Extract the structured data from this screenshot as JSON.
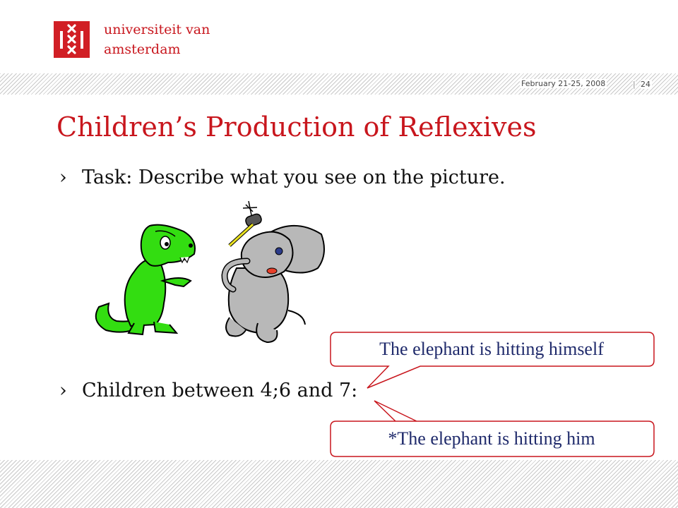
{
  "header": {
    "logo": {
      "line1": "universiteit van",
      "line2": "amsterdam",
      "icon": "uva-logo-icon",
      "color": "#d11f25"
    },
    "date": "February 21-25, 2008",
    "page_separator": "|",
    "page_number": "24"
  },
  "slide": {
    "title": "Children’s Production of Reflexives",
    "title_color": "#c8161d",
    "bullets": [
      {
        "marker": "›",
        "text": "Task: Describe what you see on the picture."
      },
      {
        "marker": "›",
        "text": "Children between 4;6 and 7:"
      }
    ],
    "callouts": [
      {
        "text": "The elephant is hitting himself"
      },
      {
        "text": "*The elephant is hitting him"
      }
    ],
    "illustration": {
      "characters": [
        "crocodile",
        "elephant"
      ],
      "held_item": "hammer"
    }
  }
}
